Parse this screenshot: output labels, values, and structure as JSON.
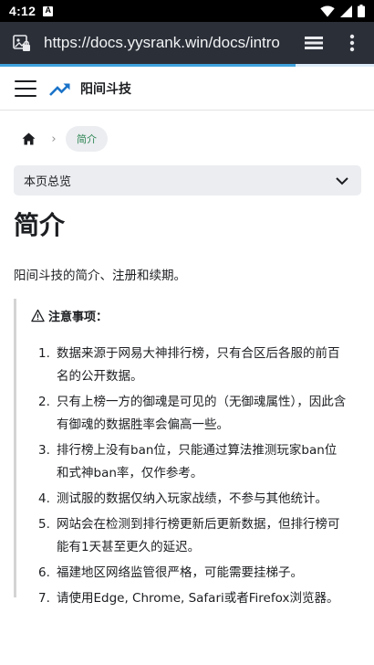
{
  "status_bar": {
    "time": "4:12",
    "notification_glyph": "A"
  },
  "browser": {
    "url": "https://docs.yysrank.win/docs/intro",
    "progress": 0.79,
    "icons": [
      "site-info-icon",
      "tabs-icon",
      "more-vert-icon"
    ]
  },
  "navbar": {
    "title": "阳间斗技",
    "logo_color": "#1a73c8"
  },
  "breadcrumb": {
    "current": "简介"
  },
  "toc": {
    "label": "本页总览"
  },
  "content": {
    "title": "简介",
    "intro": "阳间斗技的简介、注册和续期。",
    "notice": {
      "heading": "注意事项：",
      "items": [
        {
          "num": "1.",
          "text": "数据来源于网易大神排行榜，只有合区后各服的前百名的公开数据。"
        },
        {
          "num": "2.",
          "text": "只有上榜一方的御魂是可见的（无御魂属性），因此含有御魂的数据胜率会偏高一些。"
        },
        {
          "num": "3.",
          "text": "排行榜上没有ban位，只能通过算法推测玩家ban位和式神ban率，仅作参考。"
        },
        {
          "num": "4.",
          "text": "测试服的数据仅纳入玩家战绩，不参与其他统计。"
        },
        {
          "num": "5.",
          "text": "网站会在检测到排行榜更新后更新数据，但排行榜可能有1天甚至更久的延迟。"
        },
        {
          "num": "6.",
          "text": "福建地区网络监管很严格，可能需要挂梯子。"
        },
        {
          "num": "7.",
          "text": "请使用Edge, Chrome, Safari或者Firefox浏览器。"
        }
      ]
    }
  }
}
